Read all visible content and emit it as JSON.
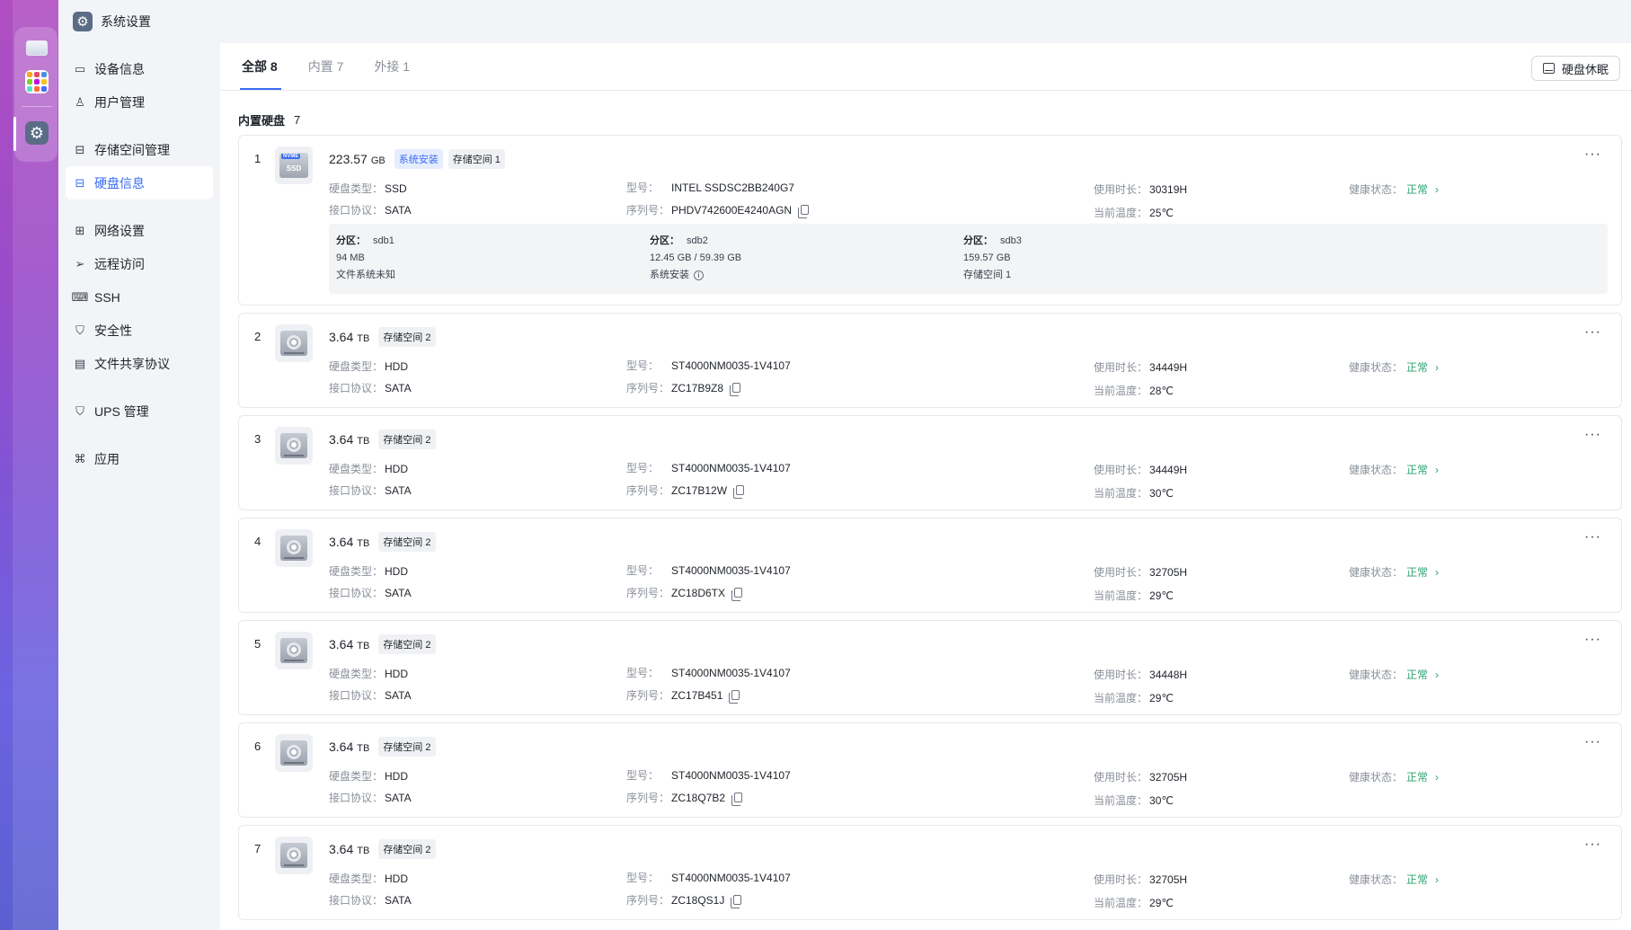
{
  "window": {
    "title": "系统设置"
  },
  "sidebar": {
    "items": [
      {
        "key": "device-info",
        "label": "设备信息",
        "icon": "device-icon"
      },
      {
        "key": "user-mgmt",
        "label": "用户管理",
        "icon": "user-icon"
      },
      {
        "key": "storage",
        "label": "存储空间管理",
        "icon": "storage-icon"
      },
      {
        "key": "disk-info",
        "label": "硬盘信息",
        "icon": "disk-icon",
        "active": true
      },
      {
        "key": "network",
        "label": "网络设置",
        "icon": "network-icon"
      },
      {
        "key": "remote",
        "label": "远程访问",
        "icon": "send-icon"
      },
      {
        "key": "ssh",
        "label": "SSH",
        "icon": "terminal-icon"
      },
      {
        "key": "security",
        "label": "安全性",
        "icon": "shield-icon"
      },
      {
        "key": "file-share",
        "label": "文件共享协议",
        "icon": "document-icon"
      },
      {
        "key": "ups",
        "label": "UPS 管理",
        "icon": "ups-shield-icon"
      },
      {
        "key": "apps",
        "label": "应用",
        "icon": "command-icon"
      }
    ]
  },
  "tabs": [
    {
      "label": "全部",
      "count": "8",
      "active": true
    },
    {
      "label": "内置",
      "count": "7"
    },
    {
      "label": "外接",
      "count": "1"
    }
  ],
  "sleep_button": "硬盘休眠",
  "section": {
    "title": "内置硬盘",
    "count": "7"
  },
  "labels": {
    "disk_type": "硬盘类型：",
    "interface": "接口协议：",
    "model": "型号：",
    "serial": "序列号：",
    "uptime": "使用时长：",
    "temperature": "当前温度：",
    "health": "健康状态：",
    "partition": "分区："
  },
  "ssd": {
    "num": "1",
    "size": "223.57",
    "unit": "GB",
    "badge_system": "系统安装",
    "badge_pool": "存储空间 1",
    "type": "SSD",
    "interface": "SATA",
    "model": "INTEL SSDSC2BB240G7",
    "serial": "PHDV742600E4240AGN",
    "uptime": "30319H",
    "temperature": "25℃",
    "health": "正常",
    "image_tag": "NVME",
    "image_text": "SSD",
    "partitions": [
      {
        "name": "sdb1",
        "size": "94 MB",
        "desc": "文件系统未知"
      },
      {
        "name": "sdb2",
        "size": "12.45 GB / 59.39 GB",
        "desc": "系统安装"
      },
      {
        "name": "sdb3",
        "size": "159.57 GB",
        "desc": "存储空间 1"
      }
    ]
  },
  "hdds": [
    {
      "num": "2",
      "size": "3.64",
      "unit": "TB",
      "pool": "存储空间 2",
      "type": "HDD",
      "interface": "SATA",
      "model": "ST4000NM0035-1V4107",
      "serial": "ZC17B9Z8",
      "uptime": "34449H",
      "temperature": "28℃",
      "health": "正常"
    },
    {
      "num": "3",
      "size": "3.64",
      "unit": "TB",
      "pool": "存储空间 2",
      "type": "HDD",
      "interface": "SATA",
      "model": "ST4000NM0035-1V4107",
      "serial": "ZC17B12W",
      "uptime": "34449H",
      "temperature": "30℃",
      "health": "正常"
    },
    {
      "num": "4",
      "size": "3.64",
      "unit": "TB",
      "pool": "存储空间 2",
      "type": "HDD",
      "interface": "SATA",
      "model": "ST4000NM0035-1V4107",
      "serial": "ZC18D6TX",
      "uptime": "32705H",
      "temperature": "29℃",
      "health": "正常"
    },
    {
      "num": "5",
      "size": "3.64",
      "unit": "TB",
      "pool": "存储空间 2",
      "type": "HDD",
      "interface": "SATA",
      "model": "ST4000NM0035-1V4107",
      "serial": "ZC17B451",
      "uptime": "34448H",
      "temperature": "29℃",
      "health": "正常"
    },
    {
      "num": "6",
      "size": "3.64",
      "unit": "TB",
      "pool": "存储空间 2",
      "type": "HDD",
      "interface": "SATA",
      "model": "ST4000NM0035-1V4107",
      "serial": "ZC18Q7B2",
      "uptime": "32705H",
      "temperature": "30℃",
      "health": "正常"
    },
    {
      "num": "7",
      "size": "3.64",
      "unit": "TB",
      "pool": "存储空间 2",
      "type": "HDD",
      "interface": "SATA",
      "model": "ST4000NM0035-1V4107",
      "serial": "ZC18QS1J",
      "uptime": "32705H",
      "temperature": "29℃",
      "health": "正常"
    }
  ],
  "colors": {
    "accent": "#3b6cf5",
    "healthy": "#2ba471"
  }
}
